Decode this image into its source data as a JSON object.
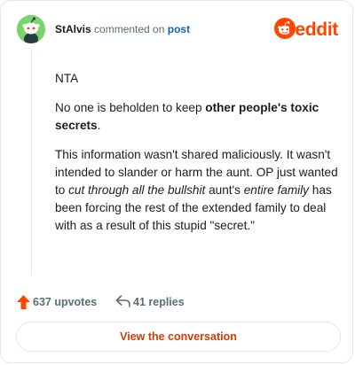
{
  "header": {
    "username": "StAlvis",
    "action_text": "commented on",
    "post_link": "post",
    "brand": "reddit"
  },
  "comment": {
    "p1": "NTA",
    "p2_pre": "No one is beholden to keep ",
    "p2_bold": "other people's toxic secrets",
    "p2_post": ".",
    "p3_a": "This information wasn't shared maliciously. It wasn't intended to slander or harm the aunt. OP just wanted to ",
    "p3_i1": "cut through all the bullshit",
    "p3_b": " aunt's ",
    "p3_i2": "entire family",
    "p3_c": " has been forcing the rest of the extended family to deal with as a result of this stupid \"secret.\""
  },
  "footer": {
    "upvotes": "637 upvotes",
    "replies": "41 replies"
  },
  "cta": {
    "label": "View the conversation"
  },
  "colors": {
    "brand": "#ff4500",
    "link": "#0a66c2",
    "avatar_bg": "#79d46e",
    "cta_text": "#d93900"
  },
  "icons": [
    "snoo-avatar-icon",
    "reddit-logo-icon",
    "upvote-arrow-icon",
    "reply-arrow-icon"
  ]
}
